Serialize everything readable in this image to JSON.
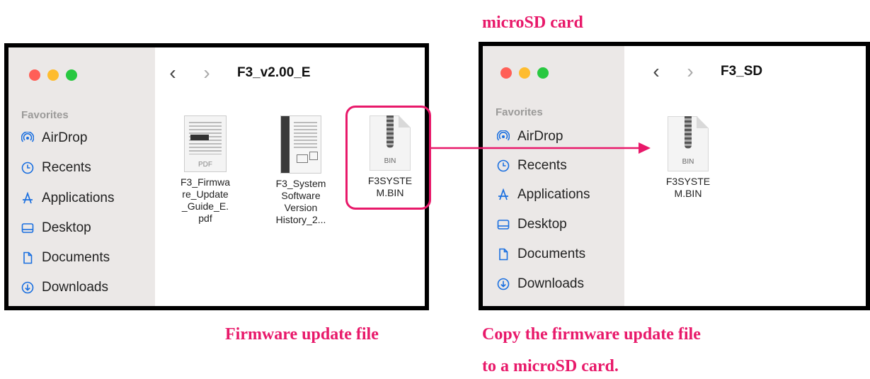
{
  "captions": {
    "microsd_label": "microSD card",
    "firmware_label": "Firmware update file",
    "copy_line1": "Copy the firmware update file",
    "copy_line2": "to a microSD card."
  },
  "left_window": {
    "title": "F3_v2.00_E",
    "sidebar": {
      "favorites_label": "Favorites",
      "items": [
        {
          "label": "AirDrop",
          "icon": "airdrop-icon"
        },
        {
          "label": "Recents",
          "icon": "clock-icon"
        },
        {
          "label": "Applications",
          "icon": "applications-icon"
        },
        {
          "label": "Desktop",
          "icon": "desktop-icon"
        },
        {
          "label": "Documents",
          "icon": "document-icon"
        },
        {
          "label": "Downloads",
          "icon": "download-icon"
        }
      ]
    },
    "files": [
      {
        "name": "F3_Firmware_Update_Guide_E.pdf",
        "thumb_label": "PDF"
      },
      {
        "name": "F3_System Software Version History_2..."
      },
      {
        "name": "F3SYSTEM.BIN",
        "thumb_label": "BIN"
      }
    ]
  },
  "right_window": {
    "title": "F3_SD",
    "sidebar": {
      "favorites_label": "Favorites",
      "items": [
        {
          "label": "AirDrop",
          "icon": "airdrop-icon"
        },
        {
          "label": "Recents",
          "icon": "clock-icon"
        },
        {
          "label": "Applications",
          "icon": "applications-icon"
        },
        {
          "label": "Desktop",
          "icon": "desktop-icon"
        },
        {
          "label": "Documents",
          "icon": "document-icon"
        },
        {
          "label": "Downloads",
          "icon": "download-icon"
        }
      ]
    },
    "files": [
      {
        "name": "F3SYSTEM.BIN",
        "thumb_label": "BIN"
      }
    ]
  },
  "colors": {
    "accent": "#e8196a",
    "sidebar_bg": "#ebe8e7",
    "sf_blue": "#1a6fe0"
  }
}
